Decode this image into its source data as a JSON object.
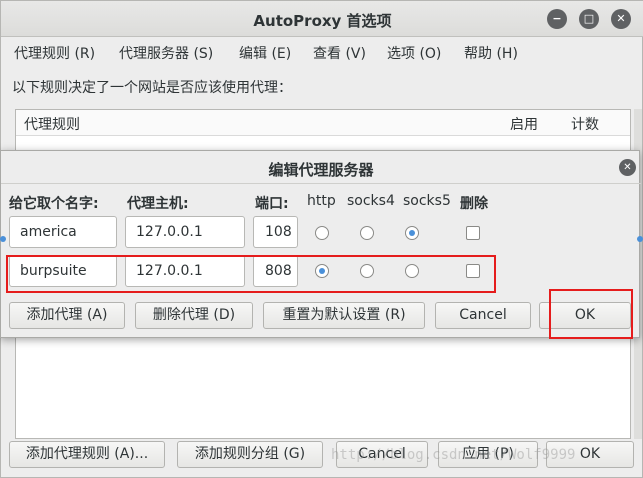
{
  "window": {
    "title": "AutoProxy 首选项",
    "controls": {
      "minimize": "−",
      "maximize": "□",
      "close": "✕"
    }
  },
  "menubar": [
    "代理规则 (R)",
    "代理服务器 (S)",
    "编辑 (E)",
    "查看 (V)",
    "选项 (O)",
    "帮助 (H)"
  ],
  "description": "以下规则决定了一个网站是否应该使用代理：",
  "rules_table": {
    "headers": [
      "代理规则",
      "启用",
      "计数"
    ]
  },
  "bottom_buttons": [
    "添加代理规则 (A)...",
    "添加规则分组 (G)",
    "Cancel",
    "应用 (P)",
    "OK"
  ],
  "watermark": "http://blog.csdn.net/Wolf9999",
  "dialog": {
    "title": "编辑代理服务器",
    "close": "✕",
    "headers": {
      "name": "给它取个名字:",
      "host": "代理主机:",
      "port": "端口:",
      "http": "http",
      "socks4": "socks4",
      "socks5": "socks5",
      "delete": "删除"
    },
    "rows": [
      {
        "name": "america",
        "host": "127.0.0.1",
        "port": "108",
        "protocol": "socks5",
        "delete": false
      },
      {
        "name": "burpsuite",
        "host": "127.0.0.1",
        "port": "808",
        "protocol": "http",
        "delete": false
      }
    ],
    "buttons": {
      "add": "添加代理 (A)",
      "remove": "删除代理 (D)",
      "reset": "重置为默认设置 (R)",
      "cancel": "Cancel",
      "ok": "OK"
    }
  },
  "colors": {
    "highlight": "#e51c1c",
    "radio_selected": "#4a90d9"
  }
}
